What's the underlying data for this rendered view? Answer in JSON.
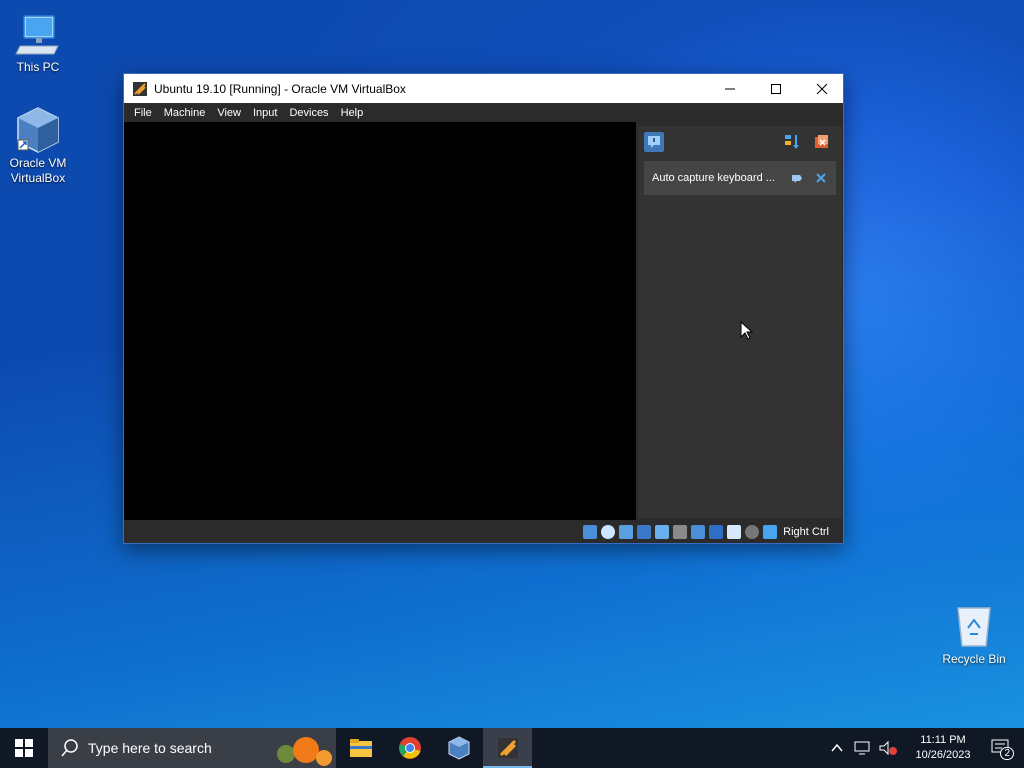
{
  "desktop": {
    "icons": [
      {
        "label": "This PC"
      },
      {
        "label": "Oracle VM VirtualBox"
      },
      {
        "label": "Recycle Bin"
      }
    ]
  },
  "window": {
    "title": "Ubuntu 19.10 [Running] - Oracle VM VirtualBox",
    "menu": [
      "File",
      "Machine",
      "View",
      "Input",
      "Devices",
      "Help"
    ],
    "notification": {
      "text": "Auto capture keyboard ..."
    },
    "statusbar": {
      "host_key": "Right Ctrl"
    }
  },
  "taskbar": {
    "search_placeholder": "Type here to search",
    "time": "11:11 PM",
    "date": "10/26/2023",
    "notification_count": "2"
  },
  "colors": {
    "taskbar": "#101826",
    "accent": "#76b9ed"
  }
}
